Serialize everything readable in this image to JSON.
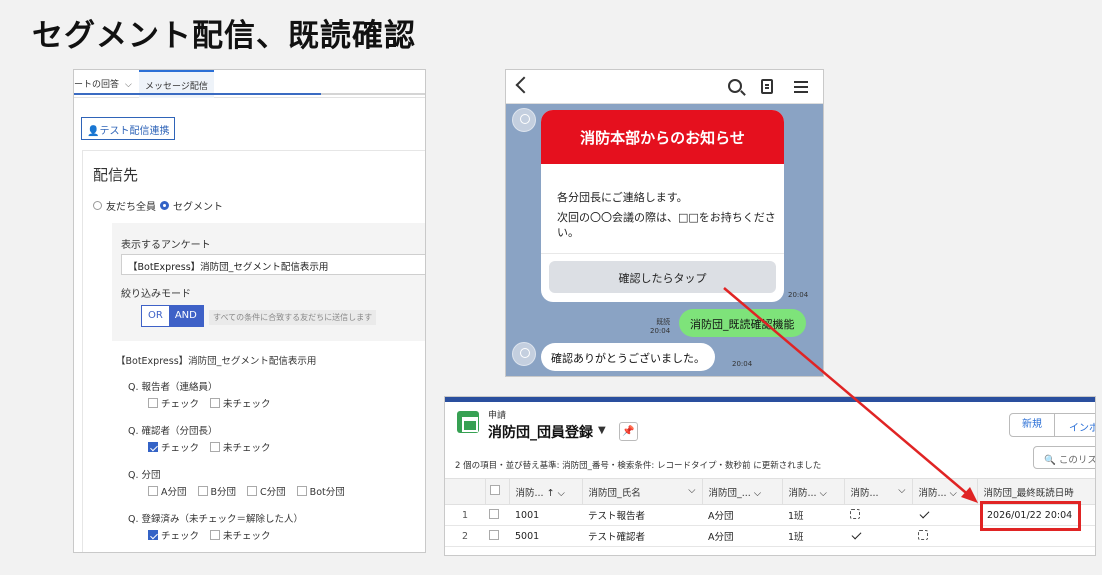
{
  "page_title": "セグメント配信、既読確認",
  "left_panel": {
    "tab_partial": "ートの回答",
    "tab_active": "メッセージ配信",
    "test_button": "テスト配信連携",
    "section_title": "配信先",
    "radio_all": "友だち全員",
    "radio_segment": "セグメント",
    "survey_label": "表示するアンケート",
    "survey_value": "【BotExpress】消防団_セグメント配信表示用",
    "mode_label": "絞り込みモード",
    "mode_or": "OR",
    "mode_and": "AND",
    "mode_hint": "すべての条件に合致する友だちに送信します",
    "survey_title": "【BotExpress】消防団_セグメント配信表示用",
    "questions": [
      {
        "q": "Q. 報告者（連絡員）",
        "options": [
          {
            "label": "チェック",
            "checked": false
          },
          {
            "label": "未チェック",
            "checked": false
          }
        ]
      },
      {
        "q": "Q. 確認者（分団長）",
        "options": [
          {
            "label": "チェック",
            "checked": true
          },
          {
            "label": "未チェック",
            "checked": false
          }
        ]
      },
      {
        "q": "Q. 分団",
        "options": [
          {
            "label": "A分団",
            "checked": false
          },
          {
            "label": "B分団",
            "checked": false
          },
          {
            "label": "C分団",
            "checked": false
          },
          {
            "label": "Bot分団",
            "checked": false
          }
        ]
      },
      {
        "q": "Q. 登録済み（未チェック＝解除した人）",
        "options": [
          {
            "label": "チェック",
            "checked": true
          },
          {
            "label": "未チェック",
            "checked": false
          }
        ]
      }
    ]
  },
  "phone": {
    "card_header": "消防本部からのお知らせ",
    "card_line1": "各分団長にご連絡します。",
    "card_line2": "次回の〇〇会議の際は、□□をお持ちください。",
    "card_button": "確認したらタップ",
    "card_time": "20:04",
    "read_label": "既読",
    "sent_time": "20:04",
    "sent_message": "消防団_既読確認機能",
    "reply_message": "確認ありがとうございました。",
    "reply_time": "20:04"
  },
  "records": {
    "object_label": "申請",
    "list_name": "消防団_団員登録",
    "btn_new": "新規",
    "btn_import": "インポ",
    "search_placeholder": "このリス",
    "status_text": "2 個の項目・並び替え基準: 消防団_番号・検索条件: レコードタイプ・数秒前 に更新されました",
    "columns": [
      "消防... ↑",
      "消防団_氏名",
      "消防団_...",
      "消防...",
      "消防...",
      "消防...",
      "消防団_最終既読日時"
    ],
    "rows": [
      {
        "n": "1",
        "id": "1001",
        "name": "テスト報告者",
        "bundan": "A分団",
        "han": "1班",
        "c1": "box",
        "c2": "check",
        "last_read": "2026/01/22 20:04"
      },
      {
        "n": "2",
        "id": "5001",
        "name": "テスト確認者",
        "bundan": "A分団",
        "han": "1班",
        "c1": "check",
        "c2": "box",
        "last_read": ""
      }
    ]
  },
  "colors": {
    "accent_red": "#e5101e",
    "line_green": "#7ee37a",
    "salesforce_blue": "#2a6fd6",
    "highlight": "#e02424"
  }
}
